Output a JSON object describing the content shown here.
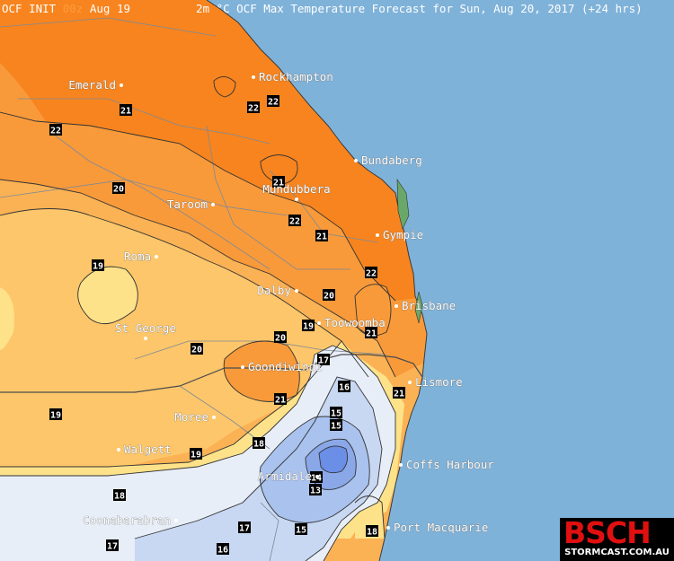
{
  "header": {
    "init_label": "OCF INIT ",
    "init_run": "00z",
    "init_date": " Aug 19",
    "title": "2m °C OCF Max Temperature Forecast for Sun, Aug 20, 2017 (+24 hrs)"
  },
  "colors": {
    "ocean": "#7fb2d9",
    "t22": "#f7841e",
    "t21": "#f89a3a",
    "t20": "#fbb254",
    "t19": "#fdc66a",
    "t18": "#fde28a",
    "t17": "#e8eef8",
    "t16": "#c8d8f2",
    "t15": "#a9c2ee",
    "t14": "#8aa8e8",
    "t13": "#6b8ee6"
  },
  "cities": [
    {
      "name": "Emerald",
      "side": "left"
    },
    {
      "name": "Rockhampton",
      "side": "right"
    },
    {
      "name": "Bundaberg",
      "side": "right"
    },
    {
      "name": "Mundubbera",
      "side": "above"
    },
    {
      "name": "Taroom",
      "side": "left"
    },
    {
      "name": "Gympie",
      "side": "right"
    },
    {
      "name": "Roma",
      "side": "left"
    },
    {
      "name": "Dalby",
      "side": "left"
    },
    {
      "name": "Brisbane",
      "side": "right"
    },
    {
      "name": "St George",
      "side": "above"
    },
    {
      "name": "Toowoomba",
      "side": "right"
    },
    {
      "name": "Goondiwindi",
      "side": "right"
    },
    {
      "name": "Lismore",
      "side": "right"
    },
    {
      "name": "Moree",
      "side": "left"
    },
    {
      "name": "Walgett",
      "side": "right"
    },
    {
      "name": "Coffs Harbour",
      "side": "right"
    },
    {
      "name": "Armidale",
      "side": "left"
    },
    {
      "name": "Port Macquarie",
      "side": "right"
    },
    {
      "name": "Coonabarabran",
      "side": "left"
    }
  ],
  "contour_labels": [
    "22",
    "21",
    "22",
    "22",
    "21",
    "20",
    "22",
    "21",
    "19",
    "22",
    "20",
    "21",
    "19",
    "20",
    "20",
    "21",
    "17",
    "16",
    "15",
    "21",
    "19",
    "15",
    "18",
    "19",
    "18",
    "14",
    "13",
    "17",
    "15",
    "16",
    "17",
    "18"
  ],
  "logo": {
    "text": "BSCH",
    "subtext": "STORMCAST.COM.AU"
  }
}
